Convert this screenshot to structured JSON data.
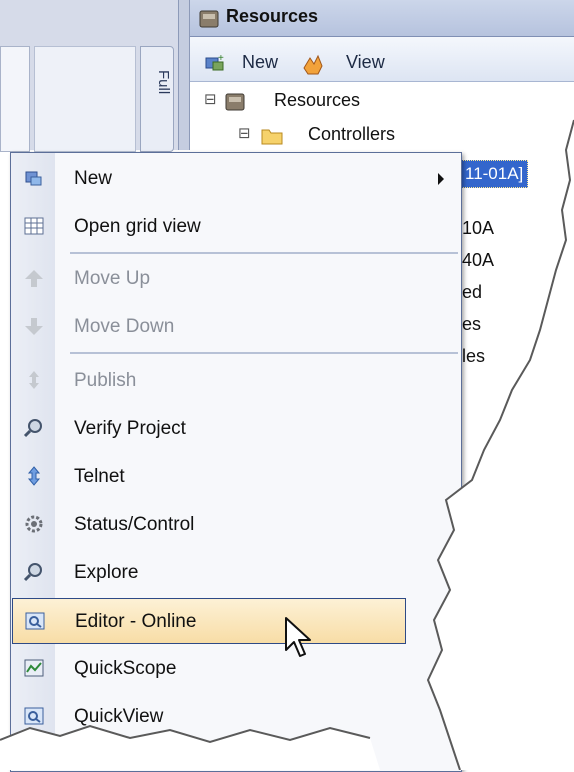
{
  "left_pane": {
    "tab_label": "Full"
  },
  "resources_panel": {
    "title": "Resources",
    "toolbar": [
      {
        "label": "New",
        "icon": "new-resource-icon"
      },
      {
        "label": "View",
        "icon": "view-hand-icon"
      }
    ],
    "tree": [
      {
        "label": "Resources",
        "expand": "⊟",
        "icon": "resources-box-icon"
      },
      {
        "label": "Controllers",
        "expand": "⊟",
        "icon": "folder-icon"
      }
    ],
    "partial_visible_text": [
      "11-01A]",
      "10A",
      "40A",
      "ed",
      "es",
      "les"
    ]
  },
  "context_menu": {
    "items": [
      {
        "label": "New",
        "icon": "new-icon",
        "enabled": true,
        "submenu": true
      },
      {
        "label": "Open grid view",
        "icon": "grid-icon",
        "enabled": true
      },
      {
        "separator": true
      },
      {
        "label": "Move Up",
        "icon": "arrow-up-icon",
        "enabled": false
      },
      {
        "label": "Move Down",
        "icon": "arrow-down-icon",
        "enabled": false
      },
      {
        "separator": true
      },
      {
        "label": "Publish",
        "icon": "publish-icon",
        "enabled": false
      },
      {
        "label": "Verify Project",
        "icon": "verify-magnifier-icon",
        "enabled": true
      },
      {
        "label": "Telnet",
        "icon": "telnet-icon",
        "enabled": true
      },
      {
        "label": "Status/Control",
        "icon": "gear-icon",
        "enabled": true
      },
      {
        "label": "Explore",
        "icon": "explore-magnifier-icon",
        "enabled": true
      },
      {
        "label": "Editor - Online",
        "icon": "editor-online-icon",
        "enabled": true,
        "highlighted": true
      },
      {
        "label": "QuickScope",
        "icon": "quickscope-icon",
        "enabled": true
      },
      {
        "label": "QuickView",
        "icon": "quickview-icon",
        "enabled": true
      }
    ]
  },
  "colors": {
    "menu_border": "#5c6f99",
    "highlight_fill": "#f8dda6",
    "disabled_text": "#8a8f99",
    "selection_blue": "#3366cc"
  }
}
